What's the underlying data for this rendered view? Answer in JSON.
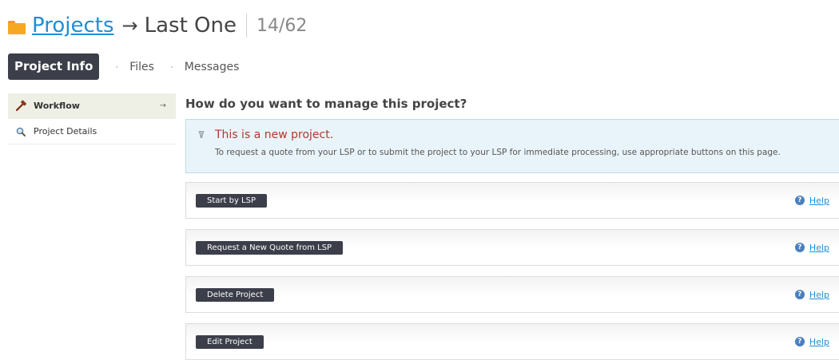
{
  "header": {
    "breadcrumb_link": "Projects",
    "arrow": "→",
    "current": "Last One",
    "counter": "14/62"
  },
  "tabs": {
    "active": "Project Info",
    "separator": "·",
    "items": [
      "Files",
      "Messages"
    ]
  },
  "sidebar": {
    "items": [
      {
        "label": "Workflow",
        "icon": "hammer-icon",
        "active": true,
        "arrow": "→"
      },
      {
        "label": "Project Details",
        "icon": "magnifier-icon",
        "active": false
      }
    ]
  },
  "main": {
    "heading": "How do you want to manage this project?",
    "notice": {
      "title": "This is a new project.",
      "text": "To request a quote from your LSP or to submit the project to your LSP for immediate processing, use appropriate buttons on this page."
    },
    "actions": [
      {
        "label": "Start by LSP",
        "help": "Help"
      },
      {
        "label": "Request a New Quote from LSP",
        "help": "Help"
      },
      {
        "label": "Delete Project",
        "help": "Help"
      },
      {
        "label": "Edit Project",
        "help": "Help"
      }
    ]
  },
  "colors": {
    "accent_dark": "#3c3f4a",
    "link_blue": "#1f8ed4",
    "notice_red": "#b03a2e",
    "notice_bg": "#e9f4fa",
    "folder_orange": "#f7a823"
  }
}
